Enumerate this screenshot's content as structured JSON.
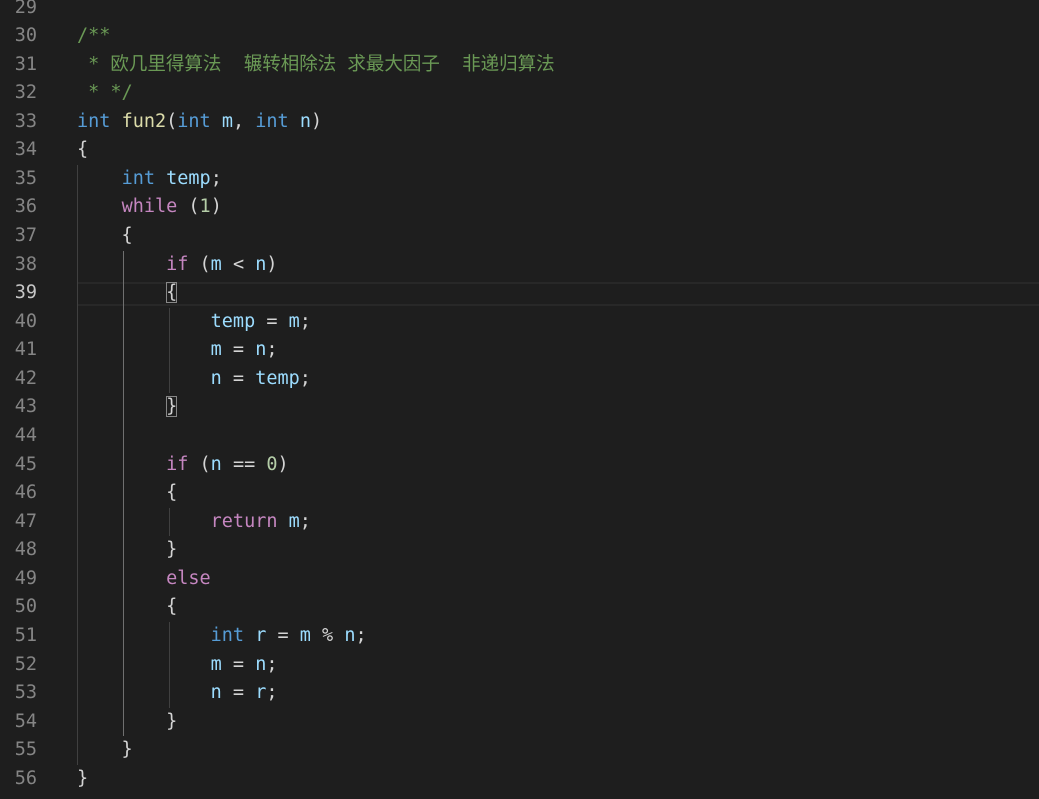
{
  "editor": {
    "active_line": "39",
    "colors": {
      "background": "#1e1e1e",
      "keyword": "#569cd6",
      "control": "#c586c0",
      "function": "#dcdcaa",
      "variable": "#9cdcfe",
      "number": "#b5cea8",
      "comment": "#6a9955",
      "line_number": "#858585"
    },
    "lines": [
      {
        "n": "29",
        "tokens": []
      },
      {
        "n": "30",
        "tokens": [
          {
            "t": "cmt",
            "v": "/**"
          }
        ]
      },
      {
        "n": "31",
        "tokens": [
          {
            "t": "cmt",
            "v": " * 欧几里得算法  辗转相除法 求最大因子  非递归算法"
          }
        ]
      },
      {
        "n": "32",
        "tokens": [
          {
            "t": "cmt",
            "v": " * */"
          }
        ]
      },
      {
        "n": "33",
        "tokens": [
          {
            "t": "kw",
            "v": "int"
          },
          {
            "t": "pun",
            "v": " "
          },
          {
            "t": "fn",
            "v": "fun2"
          },
          {
            "t": "pun",
            "v": "("
          },
          {
            "t": "kw",
            "v": "int"
          },
          {
            "t": "pun",
            "v": " "
          },
          {
            "t": "var",
            "v": "m"
          },
          {
            "t": "pun",
            "v": ", "
          },
          {
            "t": "kw",
            "v": "int"
          },
          {
            "t": "pun",
            "v": " "
          },
          {
            "t": "var",
            "v": "n"
          },
          {
            "t": "pun",
            "v": ")"
          }
        ]
      },
      {
        "n": "34",
        "tokens": [
          {
            "t": "pun",
            "v": "{"
          }
        ]
      },
      {
        "n": "35",
        "tokens": [
          {
            "t": "pun",
            "v": "    "
          },
          {
            "t": "kw",
            "v": "int"
          },
          {
            "t": "pun",
            "v": " "
          },
          {
            "t": "var",
            "v": "temp"
          },
          {
            "t": "pun",
            "v": ";"
          }
        ]
      },
      {
        "n": "36",
        "tokens": [
          {
            "t": "pun",
            "v": "    "
          },
          {
            "t": "ctl",
            "v": "while"
          },
          {
            "t": "pun",
            "v": " ("
          },
          {
            "t": "num",
            "v": "1"
          },
          {
            "t": "pun",
            "v": ")"
          }
        ]
      },
      {
        "n": "37",
        "tokens": [
          {
            "t": "pun",
            "v": "    {"
          }
        ]
      },
      {
        "n": "38",
        "tokens": [
          {
            "t": "pun",
            "v": "        "
          },
          {
            "t": "ctl",
            "v": "if"
          },
          {
            "t": "pun",
            "v": " ("
          },
          {
            "t": "var",
            "v": "m"
          },
          {
            "t": "pun",
            "v": " < "
          },
          {
            "t": "var",
            "v": "n"
          },
          {
            "t": "pun",
            "v": ")"
          }
        ]
      },
      {
        "n": "39",
        "tokens": [
          {
            "t": "pun",
            "v": "        "
          },
          {
            "t": "brk",
            "v": "{"
          }
        ]
      },
      {
        "n": "40",
        "tokens": [
          {
            "t": "pun",
            "v": "            "
          },
          {
            "t": "var",
            "v": "temp"
          },
          {
            "t": "pun",
            "v": " = "
          },
          {
            "t": "var",
            "v": "m"
          },
          {
            "t": "pun",
            "v": ";"
          }
        ]
      },
      {
        "n": "41",
        "tokens": [
          {
            "t": "pun",
            "v": "            "
          },
          {
            "t": "var",
            "v": "m"
          },
          {
            "t": "pun",
            "v": " = "
          },
          {
            "t": "var",
            "v": "n"
          },
          {
            "t": "pun",
            "v": ";"
          }
        ]
      },
      {
        "n": "42",
        "tokens": [
          {
            "t": "pun",
            "v": "            "
          },
          {
            "t": "var",
            "v": "n"
          },
          {
            "t": "pun",
            "v": " = "
          },
          {
            "t": "var",
            "v": "temp"
          },
          {
            "t": "pun",
            "v": ";"
          }
        ]
      },
      {
        "n": "43",
        "tokens": [
          {
            "t": "pun",
            "v": "        "
          },
          {
            "t": "brk",
            "v": "}"
          }
        ]
      },
      {
        "n": "44",
        "tokens": []
      },
      {
        "n": "45",
        "tokens": [
          {
            "t": "pun",
            "v": "        "
          },
          {
            "t": "ctl",
            "v": "if"
          },
          {
            "t": "pun",
            "v": " ("
          },
          {
            "t": "var",
            "v": "n"
          },
          {
            "t": "pun",
            "v": " == "
          },
          {
            "t": "num",
            "v": "0"
          },
          {
            "t": "pun",
            "v": ")"
          }
        ]
      },
      {
        "n": "46",
        "tokens": [
          {
            "t": "pun",
            "v": "        {"
          }
        ]
      },
      {
        "n": "47",
        "tokens": [
          {
            "t": "pun",
            "v": "            "
          },
          {
            "t": "ctl",
            "v": "return"
          },
          {
            "t": "pun",
            "v": " "
          },
          {
            "t": "var",
            "v": "m"
          },
          {
            "t": "pun",
            "v": ";"
          }
        ]
      },
      {
        "n": "48",
        "tokens": [
          {
            "t": "pun",
            "v": "        }"
          }
        ]
      },
      {
        "n": "49",
        "tokens": [
          {
            "t": "pun",
            "v": "        "
          },
          {
            "t": "ctl",
            "v": "else"
          }
        ]
      },
      {
        "n": "50",
        "tokens": [
          {
            "t": "pun",
            "v": "        {"
          }
        ]
      },
      {
        "n": "51",
        "tokens": [
          {
            "t": "pun",
            "v": "            "
          },
          {
            "t": "kw",
            "v": "int"
          },
          {
            "t": "pun",
            "v": " "
          },
          {
            "t": "var",
            "v": "r"
          },
          {
            "t": "pun",
            "v": " = "
          },
          {
            "t": "var",
            "v": "m"
          },
          {
            "t": "pun",
            "v": " % "
          },
          {
            "t": "var",
            "v": "n"
          },
          {
            "t": "pun",
            "v": ";"
          }
        ]
      },
      {
        "n": "52",
        "tokens": [
          {
            "t": "pun",
            "v": "            "
          },
          {
            "t": "var",
            "v": "m"
          },
          {
            "t": "pun",
            "v": " = "
          },
          {
            "t": "var",
            "v": "n"
          },
          {
            "t": "pun",
            "v": ";"
          }
        ]
      },
      {
        "n": "53",
        "tokens": [
          {
            "t": "pun",
            "v": "            "
          },
          {
            "t": "var",
            "v": "n"
          },
          {
            "t": "pun",
            "v": " = "
          },
          {
            "t": "var",
            "v": "r"
          },
          {
            "t": "pun",
            "v": ";"
          }
        ]
      },
      {
        "n": "54",
        "tokens": [
          {
            "t": "pun",
            "v": "        }"
          }
        ]
      },
      {
        "n": "55",
        "tokens": [
          {
            "t": "pun",
            "v": "    }"
          }
        ]
      },
      {
        "n": "56",
        "tokens": [
          {
            "t": "pun",
            "v": "}"
          }
        ]
      }
    ]
  }
}
